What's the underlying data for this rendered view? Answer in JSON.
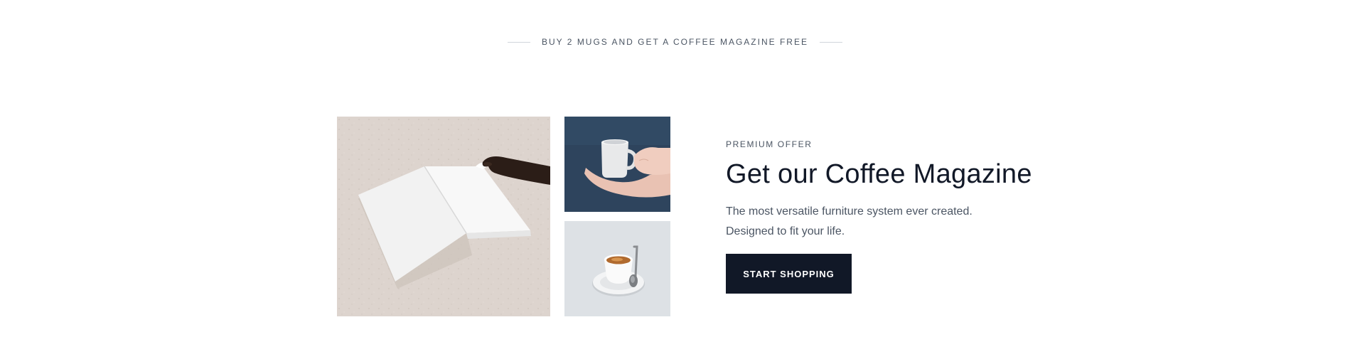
{
  "promo": {
    "text": "BUY 2 MUGS AND GET A COFFEE MAGAZINE FREE"
  },
  "offer": {
    "eyebrow": "PREMIUM OFFER",
    "headline": "Get our Coffee Magazine",
    "description": "The most versatile furniture system ever created. Designed to fit your life.",
    "cta_label": "START SHOPPING"
  },
  "images": {
    "main": "open-magazine-on-marble",
    "cup_in_hand": "hand-holding-white-mug",
    "espresso": "espresso-cup-on-saucer"
  },
  "colors": {
    "button_bg": "#111827",
    "muted_text": "#4b5563",
    "heading_text": "#111827"
  }
}
